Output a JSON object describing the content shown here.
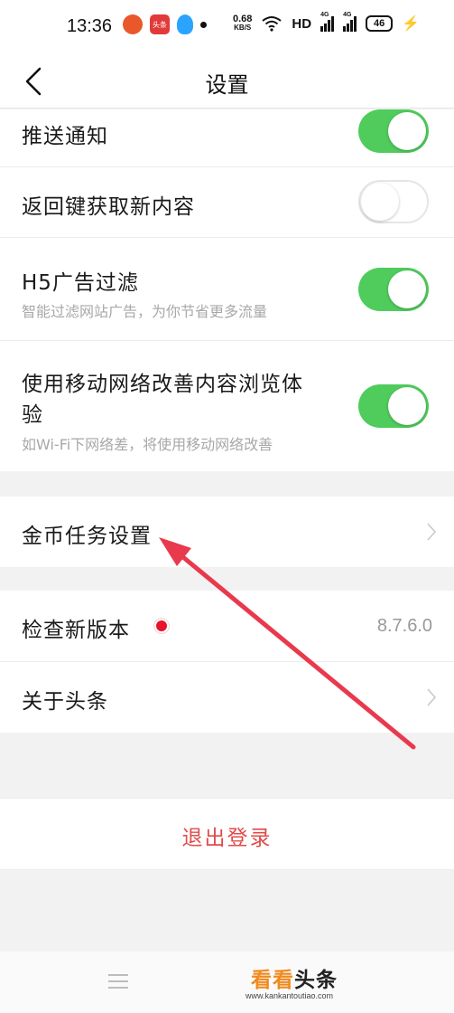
{
  "status_bar": {
    "time": "13:36",
    "app_icon_red_label": "头条",
    "net_speed_value": "0.68",
    "net_speed_unit": "KB/S",
    "hd": "HD",
    "signal1_label": "4G",
    "signal2_label": "4G",
    "battery": "46"
  },
  "nav": {
    "title": "设置"
  },
  "settings": {
    "push": {
      "title": "推送通知",
      "enabled": true
    },
    "back_key": {
      "title": "返回键获取新内容",
      "enabled": false
    },
    "h5_filter": {
      "title": "H5广告过滤",
      "subtitle": "智能过滤网站广告，为你节省更多流量",
      "enabled": true
    },
    "mobile_network": {
      "title_line1": "使用移动网络改善内容浏览体",
      "title_line2": "验",
      "subtitle": "如Wi-Fi下网络差，将使用移动网络改善",
      "enabled": true
    },
    "coin_task": {
      "title": "金币任务设置"
    },
    "check_version": {
      "title": "检查新版本",
      "version": "8.7.6.0"
    },
    "about": {
      "title": "关于头条"
    }
  },
  "logout": {
    "label": "退出登录"
  },
  "watermark": {
    "part1": "看看",
    "part2": "头条",
    "url": "www.kankantoutiao.com"
  },
  "colors": {
    "toggle_on": "#4fcc5c",
    "logout_text": "#e14b4b",
    "annotation_arrow": "#e8394d",
    "red_dot": "#e8132a"
  }
}
